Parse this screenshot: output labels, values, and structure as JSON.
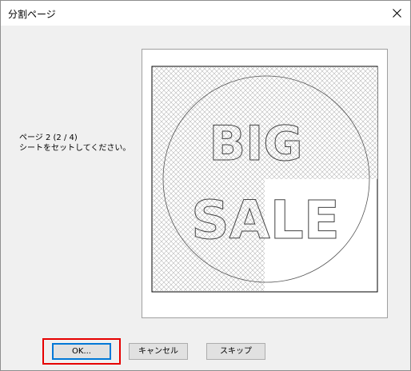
{
  "window": {
    "title": "分割ページ"
  },
  "message": {
    "line1": "ページ 2 (2 / 4)",
    "line2": "シートをセットしてください。"
  },
  "preview": {
    "line1_text": "BIG",
    "line2_text": "SALE",
    "current_page": 2,
    "total_pages": 4
  },
  "buttons": {
    "ok_label": "OK...",
    "cancel_label": "キャンセル",
    "skip_label": "スキップ"
  },
  "colors": {
    "highlight": "#e60000",
    "default_button_border": "#0078d7"
  }
}
